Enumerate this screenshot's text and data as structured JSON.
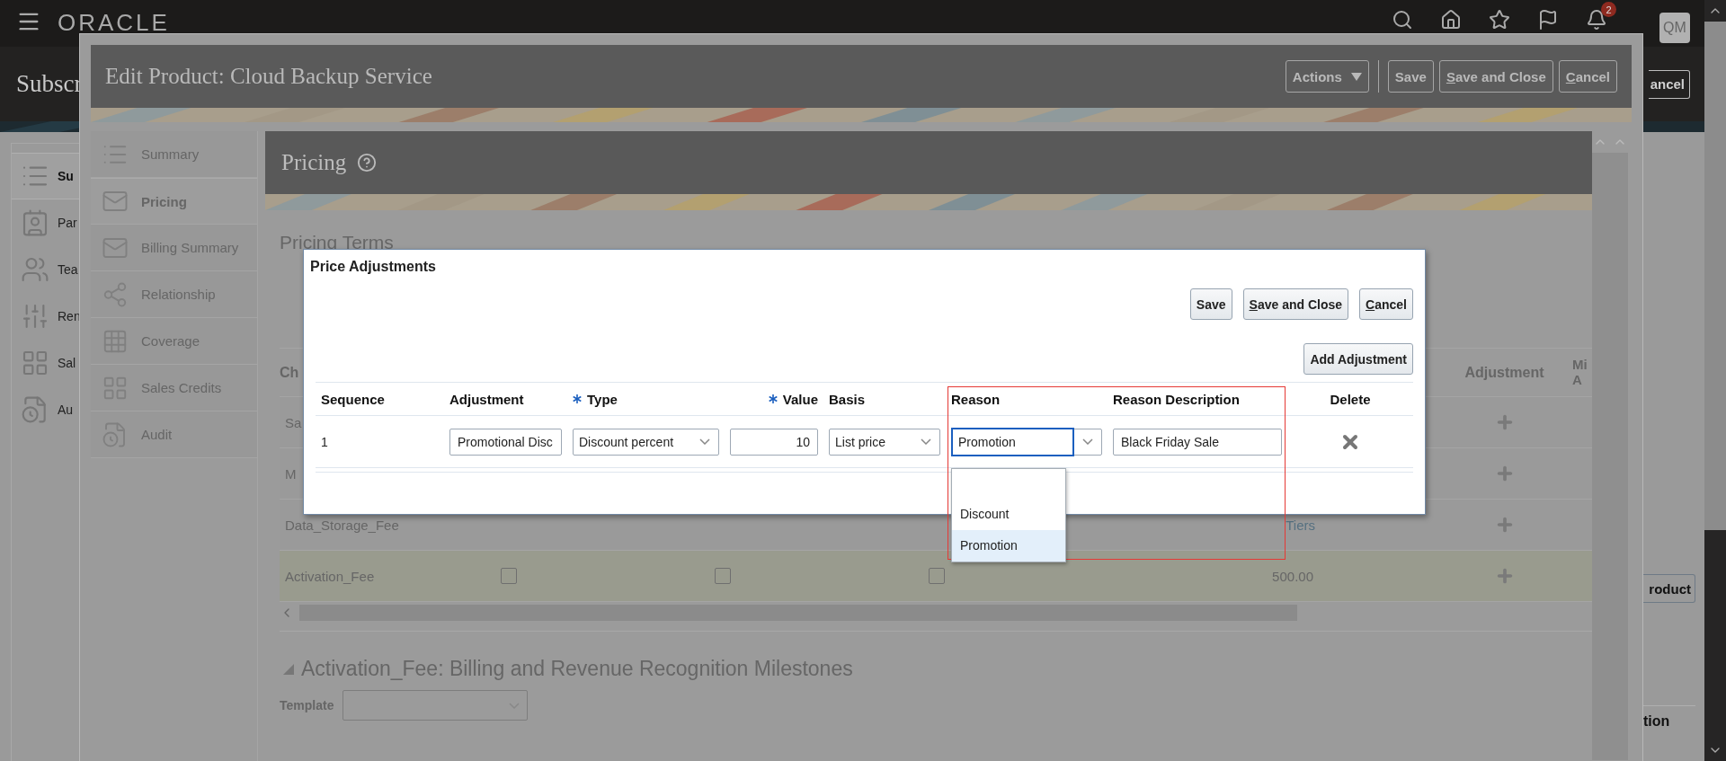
{
  "top_bar": {
    "logo": "ORACLE",
    "notifications": "2",
    "avatar": "QM"
  },
  "page": {
    "title": "Subscr",
    "cancel_button": "ancel",
    "nav": [
      {
        "label": "Su",
        "selected": true
      },
      {
        "label": "Par",
        "selected": false
      },
      {
        "label": "Tea",
        "selected": false
      },
      {
        "label": "Ren",
        "selected": false
      },
      {
        "label": "Sal",
        "selected": false
      },
      {
        "label": "Au",
        "selected": false
      }
    ],
    "product_button": "roduct",
    "section_label": "tion"
  },
  "popup": {
    "title": "Edit Product: Cloud Backup Service",
    "actions": [
      {
        "label": "Actions",
        "kind": "menu",
        "mnemonic": false
      },
      {
        "label": "Save",
        "kind": "button",
        "mnemonic": false
      },
      {
        "label": "Save and Close",
        "kind": "button",
        "mnemonic": true
      },
      {
        "label": "Cancel",
        "kind": "button",
        "mnemonic": true
      }
    ],
    "nav": [
      {
        "label": "Summary",
        "selected": false
      },
      {
        "label": "Pricing",
        "selected": true
      },
      {
        "label": "Billing Summary",
        "selected": false
      },
      {
        "label": "Relationship",
        "selected": false
      },
      {
        "label": "Coverage",
        "selected": false
      },
      {
        "label": "Sales Credits",
        "selected": false
      },
      {
        "label": "Audit",
        "selected": false
      }
    ],
    "section_title": "Pricing",
    "subsection_title": "Pricing Terms",
    "charges_table": {
      "columns": [
        "Ch",
        "Adjustment",
        "Mi A"
      ],
      "rows": [
        {
          "name": "Sa",
          "highlighted": false
        },
        {
          "name": "M",
          "highlighted": false
        },
        {
          "name": "Data_Storage_Fee",
          "link": "Tiers",
          "highlighted": false
        },
        {
          "name": "Activation_Fee",
          "amount": "500.00",
          "checkboxes": [
            {
              "checked": false
            },
            {
              "checked": false
            },
            {
              "checked": false
            }
          ],
          "highlighted": true
        }
      ]
    },
    "milestones": {
      "title": "Activation_Fee: Billing and Revenue Recognition Milestones",
      "expanded": true,
      "template_label": "Template"
    }
  },
  "dialog": {
    "title": "Price Adjustments",
    "buttons": [
      {
        "label": "Save",
        "mnemonic": false
      },
      {
        "label": "Save and Close",
        "mnemonic": true
      },
      {
        "label": "Cancel",
        "mnemonic": true
      }
    ],
    "add_button": "Add Adjustment",
    "columns": [
      {
        "label": "Sequence",
        "required": false
      },
      {
        "label": "Adjustment",
        "required": false
      },
      {
        "label": "Type",
        "required": true
      },
      {
        "label": "Value",
        "required": true
      },
      {
        "label": "Basis",
        "required": false
      },
      {
        "label": "Reason",
        "required": false
      },
      {
        "label": "Reason Description",
        "required": false
      },
      {
        "label": "Delete",
        "required": false
      }
    ],
    "rows": [
      {
        "sequence": "1",
        "adjustment": "Promotional Disc",
        "type": "Discount percent",
        "value": "10",
        "basis": "List price",
        "reason": "Promotion",
        "reason_description": "Black Friday Sale",
        "reason_expanded": true
      }
    ],
    "reason_options": [
      {
        "kind": "blank",
        "selected": false
      },
      {
        "kind": "option",
        "label": "Discount",
        "selected": false
      },
      {
        "kind": "option",
        "label": "Promotion",
        "selected": true
      }
    ]
  }
}
